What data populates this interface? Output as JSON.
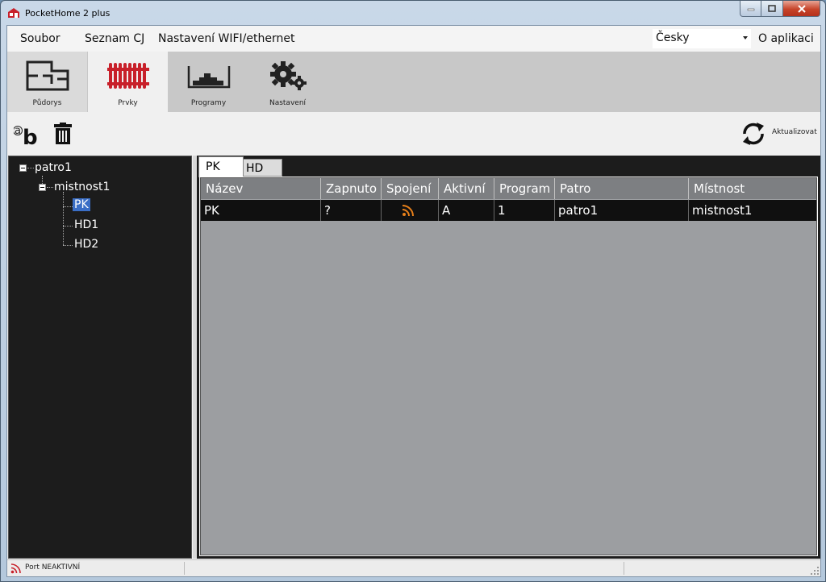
{
  "window": {
    "title": "PocketHome 2 plus",
    "colors": {
      "accent": "#c8202a",
      "selection": "#3a6ec6",
      "rss_orange": "#e8801a"
    }
  },
  "menu": {
    "items": [
      "Soubor",
      "Seznam CJ",
      "Nastavení WIFI/ethernet"
    ],
    "language": "Česky",
    "about": "O aplikaci"
  },
  "ribbon": {
    "tabs": [
      {
        "label": "Půdorys",
        "icon": "floorplan-icon"
      },
      {
        "label": "Prvky",
        "icon": "radiator-icon"
      },
      {
        "label": "Programy",
        "icon": "program-chart-icon"
      },
      {
        "label": "Nastavení",
        "icon": "gears-icon"
      }
    ],
    "active_tab": "Prvky"
  },
  "toolbar": {
    "rename_icon": "rename-icon",
    "delete_icon": "trash-icon",
    "refresh_label": "Aktualizovat"
  },
  "tree": {
    "floor": "patro1",
    "room": "mistnost1",
    "devices": [
      "PK",
      "HD1",
      "HD2"
    ],
    "selected": "PK"
  },
  "detail_tabs": [
    "PK",
    "HD"
  ],
  "grid": {
    "columns": [
      "Název",
      "Zapnuto",
      "Spojení",
      "Aktivní",
      "Program",
      "Patro",
      "Místnost"
    ],
    "rows": [
      {
        "nazev": "PK",
        "zapnuto": "?",
        "spojeni": "rss-signal-icon",
        "aktivni": "A",
        "program": "1",
        "patro": "patro1",
        "mistnost": "mistnost1"
      }
    ]
  },
  "status": {
    "port_text": "Port NEAKTIVNÍ"
  }
}
